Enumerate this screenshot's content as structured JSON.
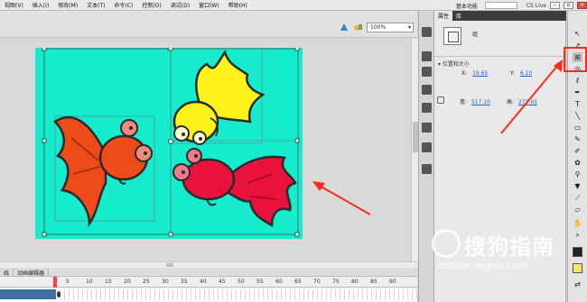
{
  "menubar": {
    "items": [
      "视图(V)",
      "插入(I)",
      "修改(M)",
      "文本(T)",
      "命令(C)",
      "控制(O)",
      "调试(D)",
      "窗口(W)",
      "帮助(H)"
    ],
    "workspace": "基本功能",
    "cs_live": "CS Live"
  },
  "stage": {
    "zoom": "100%",
    "canvas_color": "#17ebcd"
  },
  "timeline": {
    "tabs": [
      "线",
      "动画编辑器"
    ],
    "frame_numbers": [
      "5",
      "10",
      "15",
      "20",
      "25",
      "30",
      "35",
      "40",
      "45",
      "50",
      "55",
      "60",
      "65",
      "70",
      "75",
      "80",
      "85",
      "90"
    ]
  },
  "properties": {
    "tabs": [
      "属性",
      "库"
    ],
    "object_name": "组",
    "section_title": "位置和大小",
    "x_label": "X:",
    "x_value": "19.65",
    "y_label": "Y:",
    "y_value": "6.10",
    "w_label": "宽:",
    "w_value": "517.10",
    "h_label": "高:",
    "h_value": "273.65"
  },
  "watermark": {
    "text": "搜狗指南",
    "url": "zhinan.sogou.com"
  },
  "colors": {
    "highlight": "#ff2a1a",
    "fish_orange": "#ef4a1a",
    "fish_red": "#e8123c",
    "fish_yellow": "#fff21a"
  }
}
